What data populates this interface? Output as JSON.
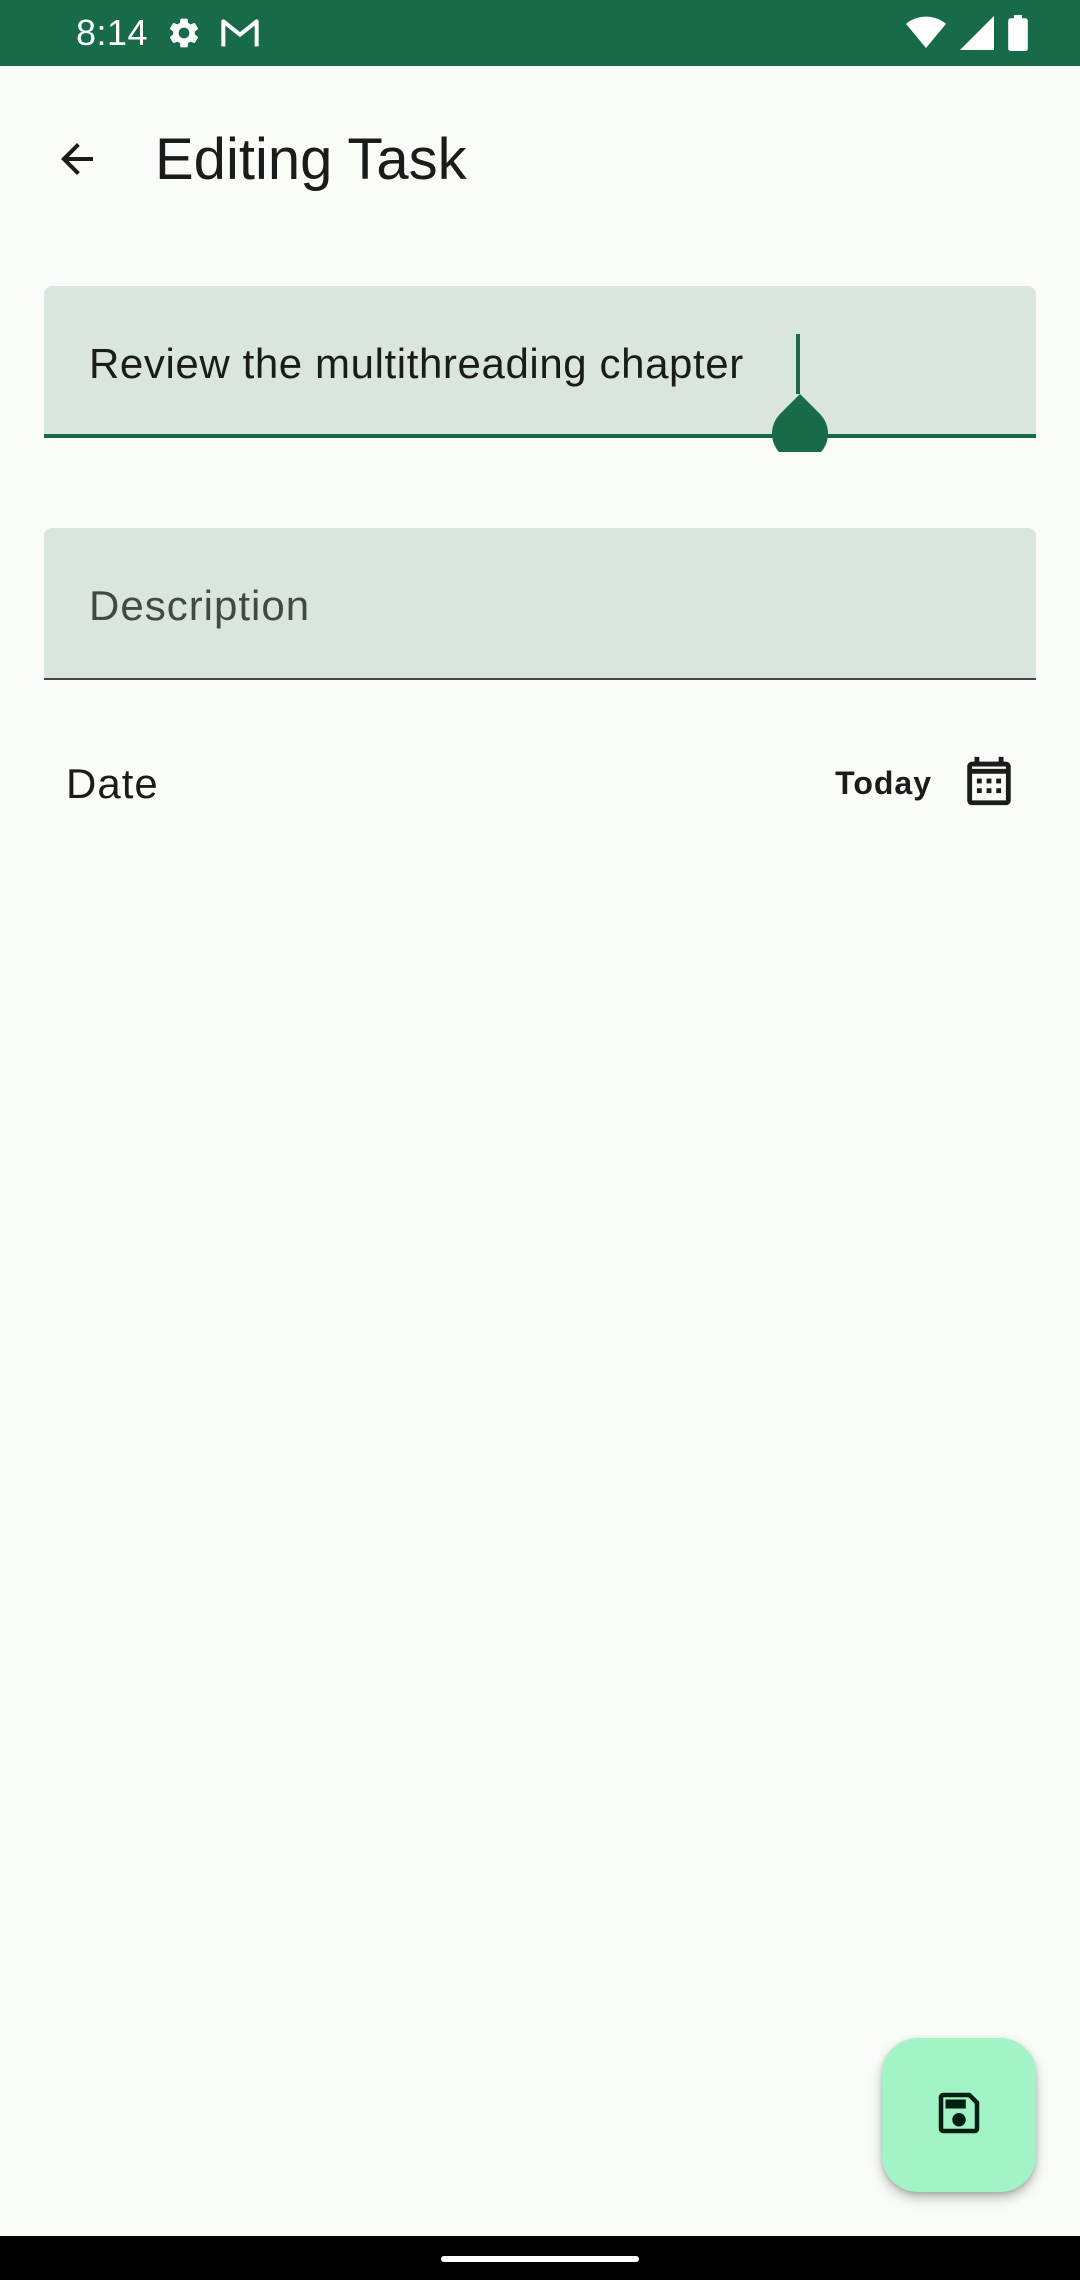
{
  "status_bar": {
    "time": "8:14",
    "icons": [
      "settings-icon",
      "gmail-icon",
      "wifi-icon",
      "signal-icon",
      "battery-icon"
    ]
  },
  "app_bar": {
    "title": "Editing Task",
    "back_icon": "arrow-back-icon"
  },
  "form": {
    "title_field": {
      "value": "Review the multithreading chapter"
    },
    "description_field": {
      "value": "",
      "placeholder": "Description"
    },
    "date": {
      "label": "Date",
      "value": "Today",
      "icon": "calendar-icon"
    }
  },
  "fab": {
    "icon": "save-icon"
  },
  "colors": {
    "primary": "#176b48",
    "field_background": "#dae5dd",
    "fab_background": "#a2f4c7",
    "surface": "#f9fcf7"
  }
}
